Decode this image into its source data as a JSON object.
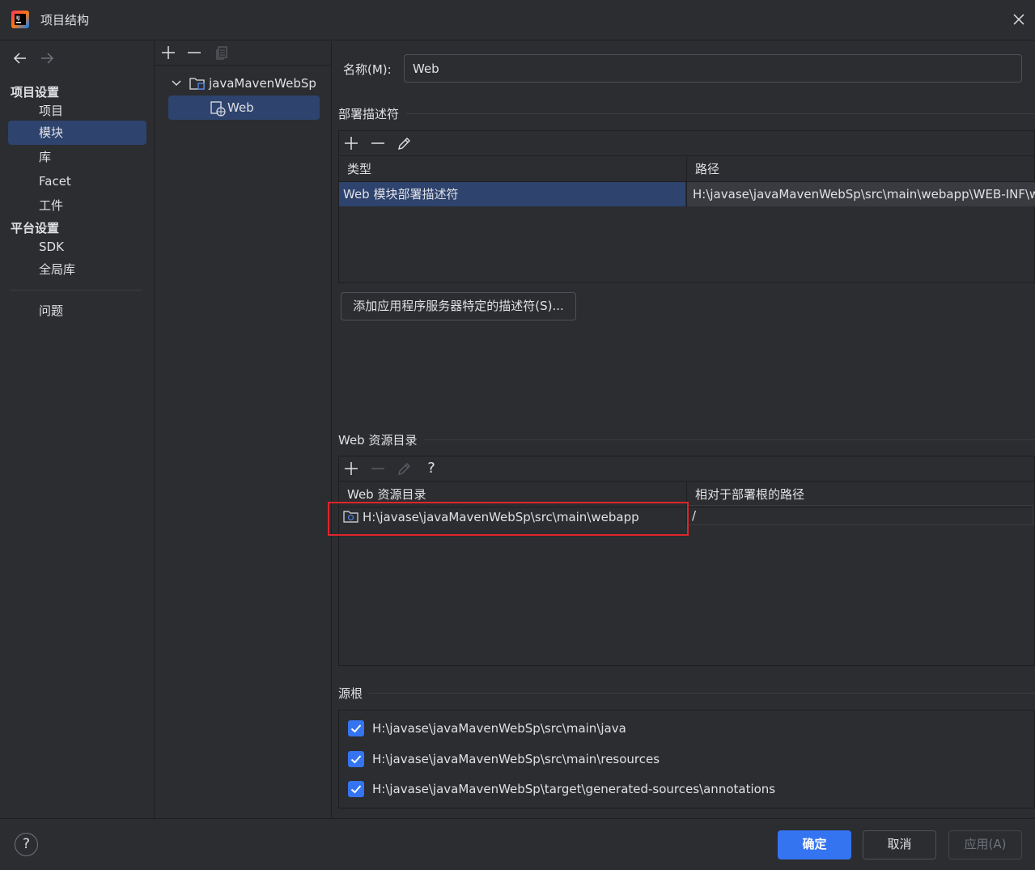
{
  "window": {
    "title": "项目结构",
    "logo": "intellij-idea-logo",
    "close_icon": "close-icon"
  },
  "left_nav": {
    "back_icon": "arrow-left-icon",
    "forward_icon": "arrow-right-icon",
    "project_settings_header": "项目设置",
    "project_settings_items": [
      "项目",
      "模块",
      "库",
      "Facet",
      "工件"
    ],
    "selected_item": "模块",
    "platform_settings_header": "平台设置",
    "platform_settings_items": [
      "SDK",
      "全局库"
    ],
    "problems": "问题"
  },
  "module_tree": {
    "toolbar_icons": [
      "add-icon",
      "remove-icon",
      "copy-icon"
    ],
    "root_label": "javaMavenWebSp",
    "child_label": "Web"
  },
  "facet": {
    "name_label": "名称(M):",
    "name_value": "Web",
    "deploy_descriptors": {
      "title": "部署描述符",
      "toolbar_icons": [
        "add-icon",
        "remove-icon",
        "edit-icon"
      ],
      "columns": [
        "类型",
        "路径"
      ],
      "rows": [
        {
          "type": "Web 模块部署描述符",
          "path": "H:\\javase\\javaMavenWebSp\\src\\main\\webapp\\WEB-INF\\web.xml"
        }
      ],
      "add_server_descriptor_button": "添加应用程序服务器特定的描述符(S)..."
    },
    "web_resources": {
      "title": "Web 资源目录",
      "toolbar_icons": [
        "add-icon",
        "remove-icon",
        "edit-icon",
        "help-icon"
      ],
      "toolbar_help_label": "?",
      "columns": [
        "Web 资源目录",
        "相对于部署根的路径"
      ],
      "rows": [
        {
          "dir": "H:\\javase\\javaMavenWebSp\\src\\main\\webapp",
          "relative": "/"
        }
      ]
    },
    "source_roots": {
      "title": "源根",
      "items": [
        {
          "path": "H:\\javase\\javaMavenWebSp\\src\\main\\java",
          "checked": true
        },
        {
          "path": "H:\\javase\\javaMavenWebSp\\src\\main\\resources",
          "checked": true
        },
        {
          "path": "H:\\javase\\javaMavenWebSp\\target\\generated-sources\\annotations",
          "checked": true
        }
      ]
    }
  },
  "footer": {
    "help_label": "?",
    "ok": "确定",
    "cancel": "取消",
    "apply": "应用(A)"
  },
  "colors": {
    "accent": "#3574f0",
    "selection": "#2e436e",
    "background": "#2b2d30",
    "highlight_box": "#e0252b"
  }
}
